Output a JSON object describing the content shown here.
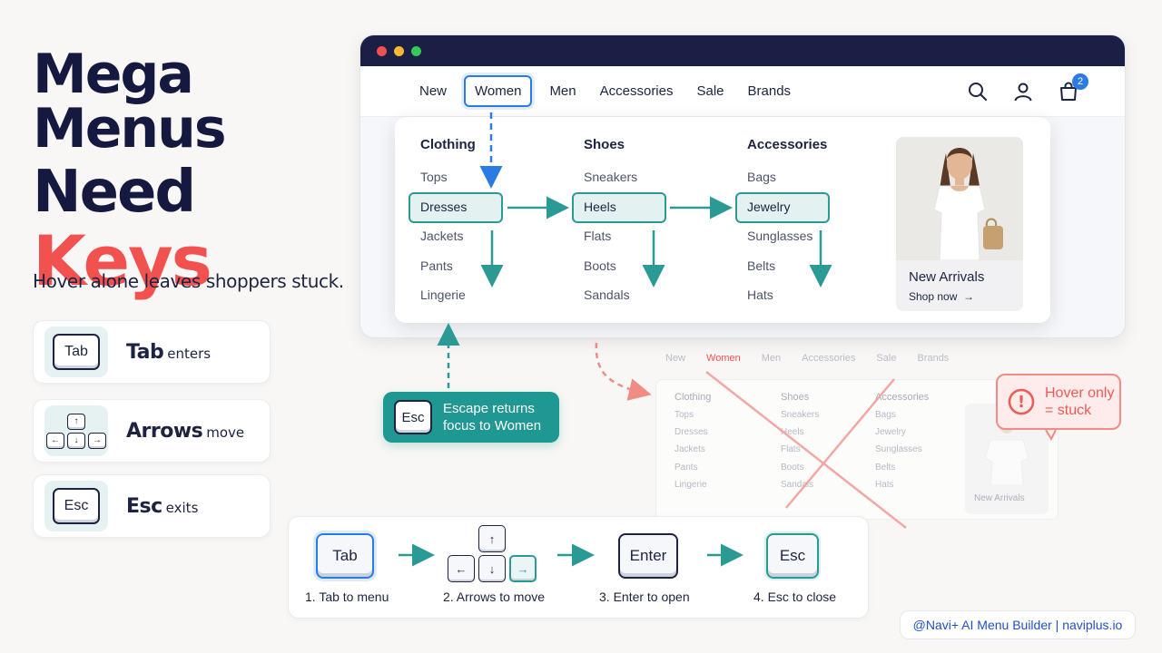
{
  "headline": {
    "line1": "Mega Menus",
    "line2": "Need",
    "line3": "Keys"
  },
  "subhead": "Hover alone leaves shoppers stuck.",
  "key_cards": [
    {
      "key": "Tab",
      "bold": "Tab",
      "rest": "enters"
    },
    {
      "key_symbols": [
        "↑",
        "←",
        "↓",
        "→"
      ],
      "bold": "Arrows",
      "rest": "move"
    },
    {
      "key": "Esc",
      "bold": "Esc",
      "rest": "exits"
    }
  ],
  "browser": {
    "nav": [
      "New",
      "Women",
      "Men",
      "Accessories",
      "Sale",
      "Brands"
    ],
    "active_nav": "Women",
    "cart_count": "2",
    "columns": [
      {
        "title": "Clothing",
        "items": [
          "Tops",
          "Dresses",
          "Jackets",
          "Pants",
          "Lingerie"
        ],
        "highlighted": "Dresses"
      },
      {
        "title": "Shoes",
        "items": [
          "Sneakers",
          "Heels",
          "Flats",
          "Boots",
          "Sandals"
        ],
        "highlighted": "Heels"
      },
      {
        "title": "Accessories",
        "items": [
          "Bags",
          "Jewelry",
          "Sunglasses",
          "Belts",
          "Hats"
        ],
        "highlighted": "Jewelry"
      }
    ],
    "promo": {
      "title": "New Arrivals",
      "cta": "Shop now",
      "cta_icon": "→"
    }
  },
  "escape_callout": {
    "key": "Esc",
    "line1": "Escape returns",
    "line2": "focus to Women"
  },
  "faded_menu": {
    "nav": [
      "New",
      "Women",
      "Men",
      "Accessories",
      "Sale",
      "Brands"
    ],
    "columns": [
      {
        "title": "Clothing",
        "items": [
          "Tops",
          "Dresses",
          "Jackets",
          "Pants",
          "Lingerie"
        ]
      },
      {
        "title": "Shoes",
        "items": [
          "Sneakers",
          "Heels",
          "Flats",
          "Boots",
          "Sandals"
        ]
      },
      {
        "title": "Accessories",
        "items": [
          "Bags",
          "Jewelry",
          "Sunglasses",
          "Belts",
          "Hats"
        ]
      }
    ],
    "promo_title": "New Arrivals"
  },
  "warning": {
    "symbol": "!",
    "line1": "Hover only",
    "line2": "= stuck"
  },
  "steps": [
    {
      "key": "Tab",
      "label": "1. Tab to menu"
    },
    {
      "arrows": [
        "↑",
        "←",
        "↓",
        "→"
      ],
      "label": "2. Arrows to move"
    },
    {
      "key": "Enter",
      "label": "3. Enter to open"
    },
    {
      "key": "Esc",
      "label": "4. Esc to close"
    }
  ],
  "footer": "@Navi+ AI Menu Builder | naviplus.io",
  "colors": {
    "navy": "#16193f",
    "coral": "#f2524f",
    "teal": "#2b9a95",
    "blue": "#2b7be5",
    "titlebar": "#1c1f45",
    "dot_red": "#f0504f",
    "dot_yellow": "#f5b934",
    "dot_green": "#35c759"
  }
}
